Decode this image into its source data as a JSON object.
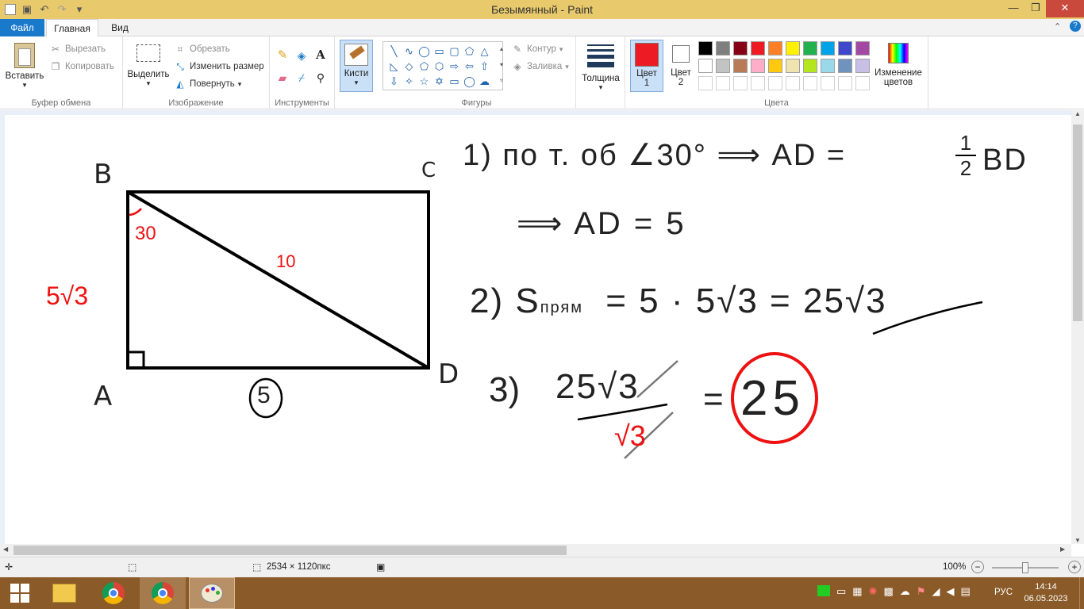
{
  "window": {
    "title": "Безымянный - Paint"
  },
  "menu": {
    "file": "Файл",
    "home": "Главная",
    "view": "Вид"
  },
  "ribbon": {
    "clipboard": {
      "paste": "Вставить",
      "cut": "Вырезать",
      "copy": "Копировать",
      "label": "Буфер обмена"
    },
    "image": {
      "select": "Выделить",
      "crop": "Обрезать",
      "resize": "Изменить размер",
      "rotate": "Повернуть",
      "label": "Изображение"
    },
    "tools": {
      "label": "Инструменты"
    },
    "brushes": {
      "label": "Кисти"
    },
    "shapes": {
      "outline": "Контур",
      "fill": "Заливка",
      "label": "Фигуры"
    },
    "size": {
      "label": "Толщина"
    },
    "colors": {
      "color1": "Цвет 1",
      "color1_l1": "Цвет",
      "color1_l2": "1",
      "color2_l1": "Цвет",
      "color2_l2": "2",
      "edit_l1": "Изменение",
      "edit_l2": "цветов",
      "label": "Цвета",
      "color1_value": "#ed1c24",
      "color2_value": "#ffffff",
      "palette": [
        "#000000",
        "#7f7f7f",
        "#880015",
        "#ed1c24",
        "#ff7f27",
        "#fff200",
        "#22b14c",
        "#00a2e8",
        "#3f48cc",
        "#a349a4",
        "#ffffff",
        "#c3c3c3",
        "#b97a57",
        "#ffaec9",
        "#ffc90e",
        "#efe4b0",
        "#b5e61d",
        "#99d9ea",
        "#7092be",
        "#c8bfe7"
      ]
    }
  },
  "drawing": {
    "labels": {
      "B": "B",
      "C": "C",
      "A": "A",
      "D": "D",
      "bottom_side": "5",
      "diagonal": "10",
      "left_side": "5√3",
      "angle": "30"
    },
    "step1a": "1) по т. об ∠30° ⟹ AD =",
    "step1_frac_num": "1",
    "step1_frac_den": "2",
    "step1_tail": "BD",
    "step1b": "⟹ AD = 5",
    "step2": "2) S",
    "step2_sub": "прям",
    "step2_rhs": "= 5 · 5√3 = 25√3",
    "step3": "3)",
    "step3_num": "25√3",
    "step3_den": "√3",
    "step3_eq": "=",
    "answer": "25"
  },
  "status": {
    "size": "2534 × 1120пкс",
    "zoom": "100%"
  },
  "taskbar": {
    "lang": "РУС",
    "time": "14:14",
    "date": "06.05.2023"
  }
}
